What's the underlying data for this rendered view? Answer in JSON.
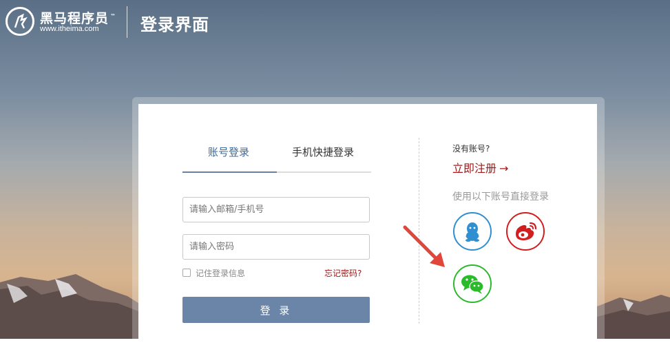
{
  "header": {
    "brand_name": "黑马程序员",
    "brand_tm": "™",
    "brand_url": "www.itheima.com",
    "page_title": "登录界面"
  },
  "tabs": [
    {
      "label": "账号登录",
      "active": true
    },
    {
      "label": "手机快捷登录",
      "active": false
    }
  ],
  "form": {
    "email_placeholder": "请输入邮箱/手机号",
    "email_value": "",
    "password_placeholder": "请输入密码",
    "password_value": "",
    "remember_label": "记住登录信息",
    "remember_checked": false,
    "forgot_label": "忘记密码?",
    "login_label": "登 录"
  },
  "side": {
    "no_account": "没有账号?",
    "register_label": "立即注册",
    "register_arrow": "→",
    "use_accounts": "使用以下账号直接登录",
    "socials": [
      {
        "name": "qq",
        "icon": "qq-icon",
        "color": "#2f8fd0"
      },
      {
        "name": "weibo",
        "icon": "weibo-icon",
        "color": "#d21e1e"
      },
      {
        "name": "wechat",
        "icon": "wechat-icon",
        "color": "#2bba2b"
      }
    ]
  },
  "colors": {
    "accent": "#6581a2",
    "login_button": "#6b85a8",
    "link_red": "#a01818",
    "annotation_arrow": "#e0463a"
  }
}
